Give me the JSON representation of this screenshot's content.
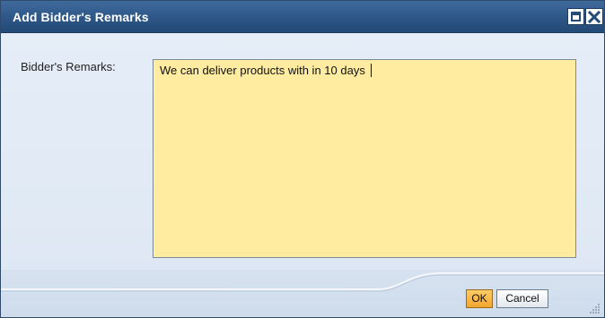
{
  "dialog": {
    "title": "Add Bidder's Remarks",
    "field_label": "Bidder's Remarks:",
    "remarks_value": "We can deliver products with in 10 days",
    "buttons": {
      "ok": "OK",
      "cancel": "Cancel"
    },
    "icons": [
      "maximize-icon",
      "close-icon",
      "resize-grip-icon"
    ],
    "colors": {
      "titlebar": "#2d5686",
      "textarea_bg": "#ffeca1",
      "ok_button": "#f3a52f"
    }
  }
}
